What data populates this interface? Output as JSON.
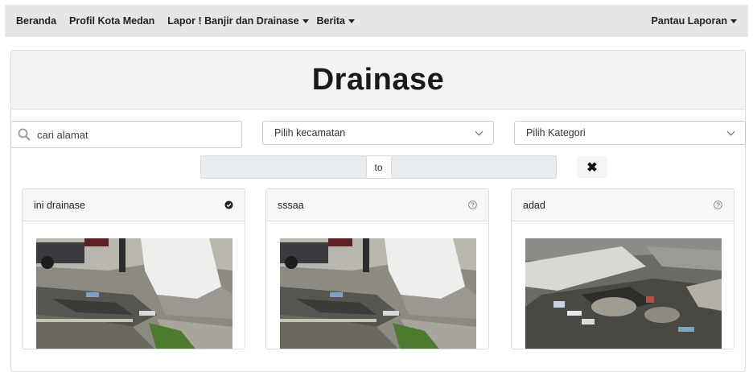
{
  "nav": {
    "beranda": "Beranda",
    "profil": "Profil Kota Medan",
    "lapor": "Lapor ! Banjir dan Drainase",
    "berita": "Berita",
    "pantau": "Pantau Laporan"
  },
  "page": {
    "title": "Drainase"
  },
  "filters": {
    "search_placeholder": "cari alamat",
    "kecamatan": "Pilih kecamatan",
    "kategori": "Pilih Kategori",
    "date_separator": "to",
    "clear_label": "✖"
  },
  "reports": [
    {
      "title": "ini drainase",
      "status": "verified"
    },
    {
      "title": "sssaa",
      "status": "unknown"
    },
    {
      "title": "adad",
      "status": "unknown"
    }
  ]
}
